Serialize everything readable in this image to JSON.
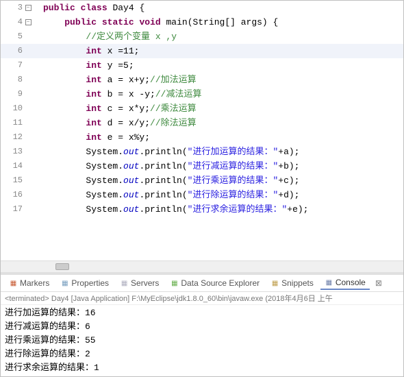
{
  "editor": {
    "highlight_line": 6,
    "fold_lines": [
      3,
      4
    ],
    "lines": [
      {
        "n": 3,
        "indent": 0,
        "tokens": [
          [
            "kw",
            "public"
          ],
          [
            " "
          ],
          [
            "kw",
            "class"
          ],
          [
            " "
          ],
          [
            "cls",
            "Day4 {"
          ]
        ]
      },
      {
        "n": 4,
        "indent": 1,
        "tokens": [
          [
            "kw",
            "public"
          ],
          [
            " "
          ],
          [
            "kw",
            "static"
          ],
          [
            " "
          ],
          [
            "bt",
            "void"
          ],
          [
            " "
          ],
          [
            "cls",
            "main(String[] args) {"
          ]
        ]
      },
      {
        "n": 5,
        "indent": 2,
        "tokens": [
          [
            "cm",
            "//定义两个变量 x ,y"
          ]
        ]
      },
      {
        "n": 6,
        "indent": 2,
        "tokens": [
          [
            "bt",
            "int"
          ],
          [
            " x =11;"
          ]
        ]
      },
      {
        "n": 7,
        "indent": 2,
        "tokens": [
          [
            "bt",
            "int"
          ],
          [
            " y =5;"
          ]
        ]
      },
      {
        "n": 8,
        "indent": 2,
        "tokens": [
          [
            "bt",
            "int"
          ],
          [
            " a = x+y;"
          ],
          [
            "cm",
            "//加法运算"
          ]
        ]
      },
      {
        "n": 9,
        "indent": 2,
        "tokens": [
          [
            "bt",
            "int"
          ],
          [
            " b = x -y;"
          ],
          [
            "cm",
            "//减法运算"
          ]
        ]
      },
      {
        "n": 10,
        "indent": 2,
        "tokens": [
          [
            "bt",
            "int"
          ],
          [
            " c = x*y;"
          ],
          [
            "cm",
            "//乘法运算"
          ]
        ]
      },
      {
        "n": 11,
        "indent": 2,
        "tokens": [
          [
            "bt",
            "int"
          ],
          [
            " d = x/y;"
          ],
          [
            "cm",
            "//除法运算"
          ]
        ]
      },
      {
        "n": 12,
        "indent": 2,
        "tokens": [
          [
            "bt",
            "int"
          ],
          [
            " e = x%y;"
          ]
        ]
      },
      {
        "n": 13,
        "indent": 2,
        "tokens": [
          [
            "cls",
            "System."
          ],
          [
            "st",
            "out"
          ],
          [
            "cls",
            ".println("
          ],
          [
            "str",
            "\"进行加运算的结果："
          ],
          [
            "str",
            "\""
          ],
          [
            "cls",
            "+a);"
          ]
        ]
      },
      {
        "n": 14,
        "indent": 2,
        "tokens": [
          [
            "cls",
            "System."
          ],
          [
            "st",
            "out"
          ],
          [
            "cls",
            ".println("
          ],
          [
            "str",
            "\"进行减运算的结果："
          ],
          [
            "str",
            "\""
          ],
          [
            "cls",
            "+b);"
          ]
        ]
      },
      {
        "n": 15,
        "indent": 2,
        "tokens": [
          [
            "cls",
            "System."
          ],
          [
            "st",
            "out"
          ],
          [
            "cls",
            ".println("
          ],
          [
            "str",
            "\"进行乘运算的结果："
          ],
          [
            "str",
            "\""
          ],
          [
            "cls",
            "+c);"
          ]
        ]
      },
      {
        "n": 16,
        "indent": 2,
        "tokens": [
          [
            "cls",
            "System."
          ],
          [
            "st",
            "out"
          ],
          [
            "cls",
            ".println("
          ],
          [
            "str",
            "\"进行除运算的结果："
          ],
          [
            "str",
            "\""
          ],
          [
            "cls",
            "+d);"
          ]
        ]
      },
      {
        "n": 17,
        "indent": 2,
        "tokens": [
          [
            "cls",
            "System."
          ],
          [
            "st",
            "out"
          ],
          [
            "cls",
            ".println("
          ],
          [
            "str",
            "\"进行求余运算的结果："
          ],
          [
            "str",
            "\""
          ],
          [
            "cls",
            "+e);"
          ]
        ]
      }
    ]
  },
  "tabs": {
    "items": [
      {
        "label": "Markers",
        "icon_color": "#c75a32"
      },
      {
        "label": "Properties",
        "icon_color": "#7aa0c0"
      },
      {
        "label": "Servers",
        "icon_color": "#b0b0c0"
      },
      {
        "label": "Data Source Explorer",
        "icon_color": "#6ab050"
      },
      {
        "label": "Snippets",
        "icon_color": "#c0a050"
      },
      {
        "label": "Console",
        "icon_color": "#6c7ea8",
        "active": true
      }
    ],
    "more_glyph": "⊠"
  },
  "console": {
    "status": "<terminated> Day4 [Java Application] F:\\MyEclipse\\jdk1.8.0_60\\bin\\javaw.exe (2018年4月6日 上午",
    "output": [
      "进行加运算的结果：16",
      "进行减运算的结果：6",
      "进行乘运算的结果：55",
      "进行除运算的结果：2",
      "进行求余运算的结果：1"
    ]
  }
}
